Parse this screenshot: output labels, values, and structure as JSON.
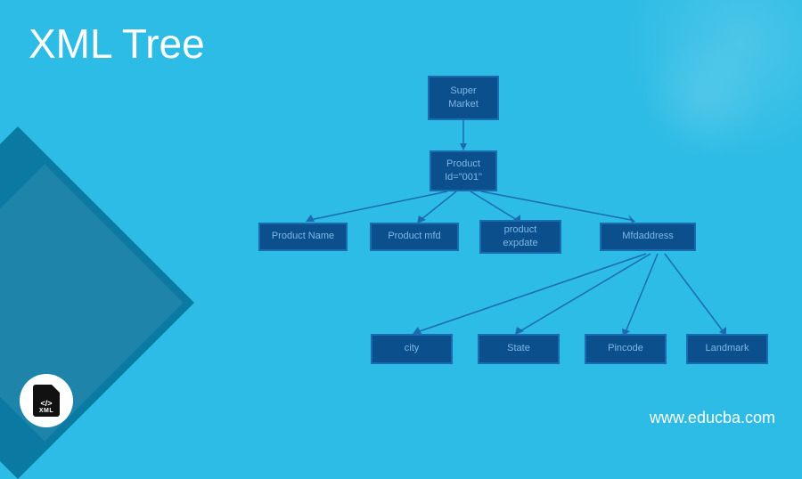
{
  "title": "XML Tree",
  "site_url": "www.educba.com",
  "icon": {
    "label": "XML",
    "bracket": "</>",
    "name": "xml-file-icon"
  },
  "nodes": {
    "root": {
      "line1": "Super",
      "line2": "Market"
    },
    "product": {
      "line1": "Product",
      "line2": "Id=\"001\""
    },
    "level2": {
      "n0": "Product Name",
      "n1": "Product mfd",
      "n2_line1": "product",
      "n2_line2": "expdate",
      "n3": "Mfdaddress"
    },
    "level3": {
      "n0": "city",
      "n1": "State",
      "n2": "Pincode",
      "n3": "Landmark"
    }
  }
}
